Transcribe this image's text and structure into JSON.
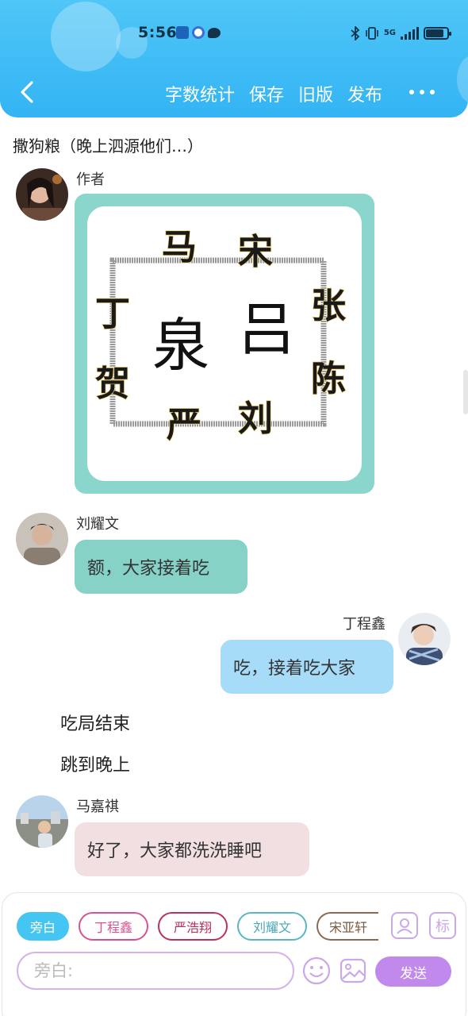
{
  "status_bar": {
    "time": "5:56",
    "network": "5G"
  },
  "toolbar": {
    "word_count": "字数统计",
    "save": "保存",
    "old_version": "旧版",
    "publish": "发布"
  },
  "chapter": {
    "title": "撒狗粮（晚上泗源他们…）"
  },
  "messages": {
    "author": {
      "name": "作者"
    },
    "image_chars": {
      "top_left": "马",
      "top_right": "宋",
      "left_upper": "丁",
      "left_lower": "贺",
      "right_upper": "张",
      "right_lower": "陈",
      "bottom_left": "严",
      "bottom_right": "刘",
      "center_left": "泉",
      "center_right": "吕"
    },
    "liu": {
      "name": "刘耀文",
      "text": "额，大家接着吃"
    },
    "ding": {
      "name": "丁程鑫",
      "text": "吃，接着吃大家"
    },
    "narration1": "吃局结束",
    "narration2": "跳到晚上",
    "ma": {
      "name": "马嘉祺",
      "text": "好了，大家都洗洗睡吧"
    }
  },
  "input_panel": {
    "chips": [
      "旁白",
      "丁程鑫",
      "严浩翔",
      "刘耀文",
      "宋亚轩"
    ],
    "tag_button": "标",
    "placeholder": "旁白:",
    "send": "发送"
  },
  "colors": {
    "header": "#33b4f4",
    "teal_bubble": "#86d2c7",
    "blue_bubble": "#a6dcf8",
    "pink_bubble": "#f2dfe1",
    "send_button": "#c189ec"
  }
}
